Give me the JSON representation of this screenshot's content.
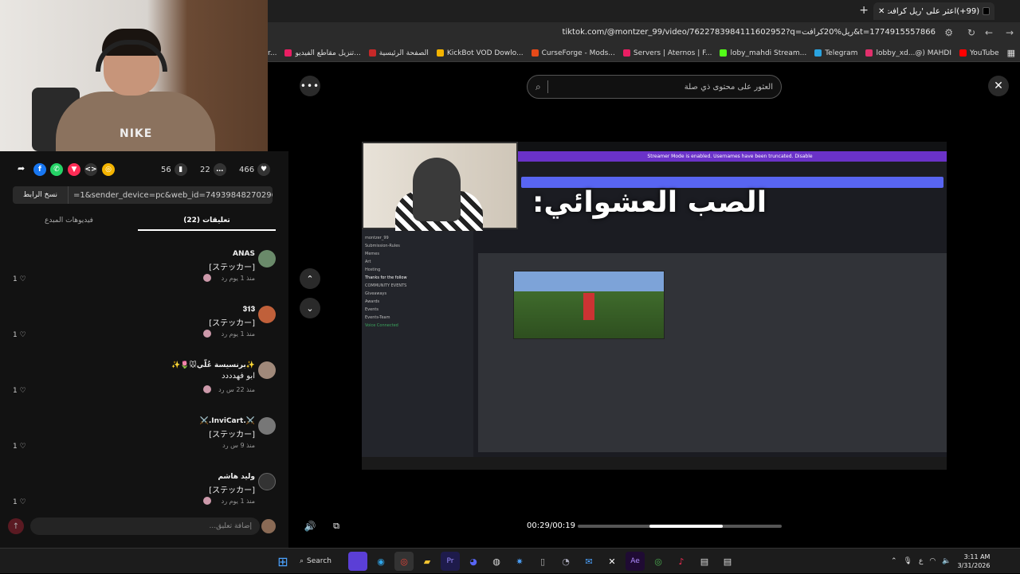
{
  "browser": {
    "tab_title": "(99+)اعثر على 'ريل كرافت' ...",
    "new_tab": "+",
    "url": "tiktok.com/@montzer_99/video/7622783984111602952?q=ريل%20كرافت&t=1774915557866",
    "bookmarks": [
      {
        "label": "AI Image Generator...",
        "color": "#888888"
      },
      {
        "label": "تنزيل مقاطع الفيديو...",
        "color": "#e91e63"
      },
      {
        "label": "الصفحة الرئيسية",
        "color": "#e91e63"
      },
      {
        "label": "KickBot VOD Dowlo...",
        "color": "#c62828"
      },
      {
        "label": "CurseForge - Mods...",
        "color": "#f4b400"
      },
      {
        "label": "Servers | Aternos | F...",
        "color": "#e64a19"
      },
      {
        "label": "loby_mahdi Stream...",
        "color": "#e91e63"
      },
      {
        "label": "Telegram",
        "color": "#53fc18"
      },
      {
        "label": "lobby_xd...@) MAHDI",
        "color": "#2aa3e0"
      },
      {
        "label": "YouTube",
        "color": "#e1306c"
      }
    ],
    "bookmarks_tail_color": "#ff0000"
  },
  "share": {
    "likes": "466",
    "comments": "22",
    "saves": "56",
    "copy_link_label": "نسخ الرابط",
    "link_text": "=1&sender_device=pc&web_id=7493984827029669431"
  },
  "tabs": {
    "comments_label": "تعليقات (22)",
    "creator_videos_label": "فيديوهات المبدع"
  },
  "comments": [
    {
      "name": "ANAS",
      "text": "[ステッカー]",
      "meta": "منذ 1 يوم   رد",
      "likes": "1",
      "avatar_color": "#6a8a6a"
    },
    {
      "name": "𝟑𝟏𝟑",
      "text": "[ステッカー]",
      "meta": "منذ 1 يوم   رد",
      "likes": "1",
      "avatar_color": "#c0603a"
    },
    {
      "name": "✨برنسيسة عُلّي🐭🌷✨",
      "text": "ابو فهدددد",
      "meta": "منذ 22 س   رد",
      "likes": "1",
      "avatar_color": "#a0897a"
    },
    {
      "name": "⚔️.InviCart.⚔️",
      "text": "[ステッカー]",
      "meta": "منذ 9 س   رد",
      "likes": "1",
      "avatar_color": "#777777"
    },
    {
      "name": "وليد هاشم",
      "text": "[ステッカー]",
      "meta": "منذ 1 يوم   رد",
      "likes": "1",
      "avatar_color": "#333333"
    }
  ],
  "comment_input": {
    "placeholder": "إضافة تعليق..."
  },
  "player": {
    "search_placeholder": "العثور على محتوى ذي صلة",
    "video_title": "الصب العشوائي:",
    "streamer_mode_text": "Streamer Mode is enabled. Usernames have been truncated.  Disable",
    "time": "00:29/00:19",
    "progress": 0.36,
    "channel_items": [
      "montzer_99",
      "Submission-Rules",
      "Memes",
      "Art",
      "Hosting",
      "Thanks for the follow",
      "COMMUNITY EVENTS",
      "Giveaways",
      "Awards",
      "Events",
      "Events-Team",
      "Voice Connected"
    ]
  },
  "taskbar": {
    "search_label": "Search",
    "time": "3:11 AM",
    "date": "3/31/2026",
    "lang": "ع"
  }
}
